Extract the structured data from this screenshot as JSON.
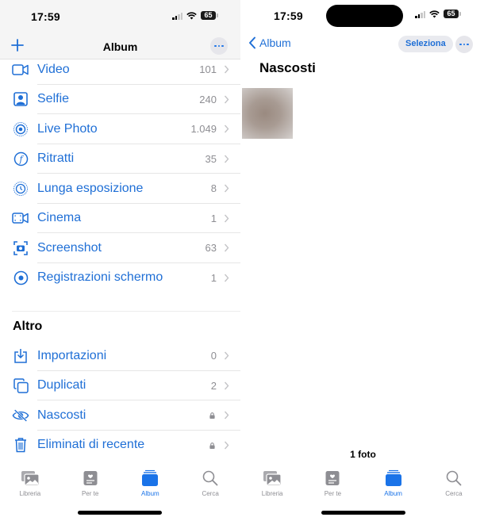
{
  "left_screen": {
    "status_bar": {
      "time": "17:59",
      "battery": "65"
    },
    "nav": {
      "title": "Album",
      "add_icon": "plus-icon",
      "more_icon": "ellipsis-icon"
    },
    "media_types": [
      {
        "label": "Video",
        "count": "101",
        "icon": "video-icon"
      },
      {
        "label": "Selfie",
        "count": "240",
        "icon": "selfie-portrait-icon"
      },
      {
        "label": "Live Photo",
        "count": "1.049",
        "icon": "live-photo-icon"
      },
      {
        "label": "Ritratti",
        "count": "35",
        "icon": "portrait-aperture-icon"
      },
      {
        "label": "Lunga esposizione",
        "count": "8",
        "icon": "long-exposure-icon"
      },
      {
        "label": "Cinema",
        "count": "1",
        "icon": "cinematic-icon"
      },
      {
        "label": "Screenshot",
        "count": "63",
        "icon": "screenshot-icon"
      },
      {
        "label": "Registrazioni schermo",
        "count": "1",
        "icon": "screen-recording-icon"
      }
    ],
    "other_section": {
      "title": "Altro",
      "items": [
        {
          "label": "Importazioni",
          "count": "0",
          "icon": "import-icon",
          "locked": false
        },
        {
          "label": "Duplicati",
          "count": "2",
          "icon": "duplicates-icon",
          "locked": false
        },
        {
          "label": "Nascosti",
          "count": "",
          "icon": "eye-slash-icon",
          "locked": true
        },
        {
          "label": "Eliminati di recente",
          "count": "",
          "icon": "trash-icon",
          "locked": true
        }
      ]
    },
    "tabbar": [
      {
        "label": "Libreria",
        "icon": "library-icon",
        "active": false
      },
      {
        "label": "Per te",
        "icon": "for-you-icon",
        "active": false
      },
      {
        "label": "Album",
        "icon": "album-icon",
        "active": true
      },
      {
        "label": "Cerca",
        "icon": "search-icon",
        "active": false
      }
    ]
  },
  "right_screen": {
    "status_bar": {
      "time": "17:59",
      "battery": "65"
    },
    "nav": {
      "back_label": "Album",
      "select_label": "Seleziona"
    },
    "title": "Nascosti",
    "photo_count_label": "1 foto",
    "tabbar": [
      {
        "label": "Libreria",
        "icon": "library-icon",
        "active": false
      },
      {
        "label": "Per te",
        "icon": "for-you-icon",
        "active": false
      },
      {
        "label": "Album",
        "icon": "album-icon",
        "active": true
      },
      {
        "label": "Cerca",
        "icon": "search-icon",
        "active": false
      }
    ]
  },
  "colors": {
    "accent": "#1f6fd6",
    "tab_active": "#1a73e8",
    "secondary_text": "#8e8e93"
  }
}
